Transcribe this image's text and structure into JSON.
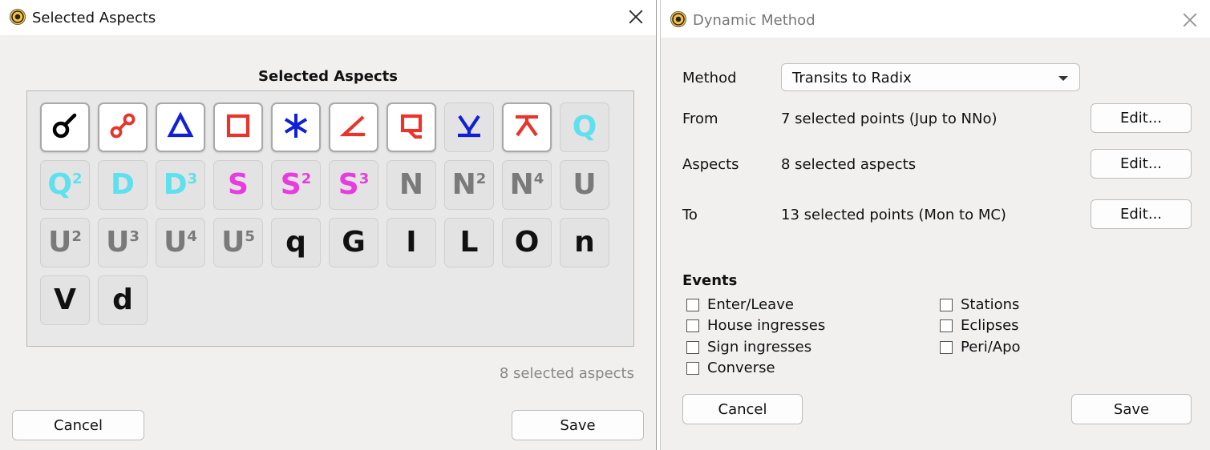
{
  "aspects_window": {
    "title": "Selected Aspects",
    "heading": "Selected Aspects",
    "status": "8 selected aspects",
    "cancel_label": "Cancel",
    "save_label": "Save",
    "aspects": [
      {
        "icon": "conjunction-icon",
        "selected": true,
        "color": "#000000"
      },
      {
        "icon": "opposition-icon",
        "selected": true,
        "color": "#e8352b"
      },
      {
        "icon": "trine-icon",
        "selected": true,
        "color": "#1020d8"
      },
      {
        "icon": "square-icon",
        "selected": true,
        "color": "#e8352b"
      },
      {
        "icon": "sextile-icon",
        "selected": true,
        "color": "#1020d8"
      },
      {
        "icon": "semisquare-icon",
        "selected": true,
        "color": "#e8352b"
      },
      {
        "icon": "sesquisquare-icon",
        "selected": true,
        "color": "#e8352b"
      },
      {
        "icon": "semisextile-icon",
        "selected": false,
        "color": "#1020d8"
      },
      {
        "icon": "quincunx-icon",
        "selected": true,
        "color": "#e8352b"
      },
      {
        "text": "Q",
        "sup": "",
        "selected": false,
        "color": "#5ee0ef"
      },
      {
        "text": "Q",
        "sup": "2",
        "selected": false,
        "color": "#5ee0ef"
      },
      {
        "text": "D",
        "sup": "",
        "selected": false,
        "color": "#5ee0ef"
      },
      {
        "text": "D",
        "sup": "3",
        "selected": false,
        "color": "#5ee0ef"
      },
      {
        "text": "S",
        "sup": "",
        "selected": false,
        "color": "#e83ce0"
      },
      {
        "text": "S",
        "sup": "2",
        "selected": false,
        "color": "#e83ce0"
      },
      {
        "text": "S",
        "sup": "3",
        "selected": false,
        "color": "#e83ce0"
      },
      {
        "text": "N",
        "sup": "",
        "selected": false,
        "color": "#7a7a7a"
      },
      {
        "text": "N",
        "sup": "2",
        "selected": false,
        "color": "#7a7a7a"
      },
      {
        "text": "N",
        "sup": "4",
        "selected": false,
        "color": "#7a7a7a"
      },
      {
        "text": "U",
        "sup": "",
        "selected": false,
        "color": "#7a7a7a"
      },
      {
        "text": "U",
        "sup": "2",
        "selected": false,
        "color": "#7a7a7a"
      },
      {
        "text": "U",
        "sup": "3",
        "selected": false,
        "color": "#7a7a7a"
      },
      {
        "text": "U",
        "sup": "4",
        "selected": false,
        "color": "#7a7a7a"
      },
      {
        "text": "U",
        "sup": "5",
        "selected": false,
        "color": "#7a7a7a"
      },
      {
        "text": "q",
        "sup": "",
        "selected": false,
        "color": "#111111"
      },
      {
        "text": "G",
        "sup": "",
        "selected": false,
        "color": "#111111"
      },
      {
        "text": "I",
        "sup": "",
        "selected": false,
        "color": "#111111"
      },
      {
        "text": "L",
        "sup": "",
        "selected": false,
        "color": "#111111"
      },
      {
        "text": "O",
        "sup": "",
        "selected": false,
        "color": "#111111"
      },
      {
        "text": "n",
        "sup": "",
        "selected": false,
        "color": "#111111"
      },
      {
        "text": "V",
        "sup": "",
        "selected": false,
        "color": "#111111"
      },
      {
        "text": "d",
        "sup": "",
        "selected": false,
        "color": "#111111"
      }
    ]
  },
  "dynamic_window": {
    "title": "Dynamic Method",
    "method_label": "Method",
    "method_value": "Transits to Radix",
    "from_label": "From",
    "from_value": "7 selected points (Jup to NNo)",
    "aspects_label": "Aspects",
    "aspects_value": "8 selected aspects",
    "to_label": "To",
    "to_value": "13 selected points (Mon to MC)",
    "edit_label": "Edit...",
    "events_heading": "Events",
    "events_left": [
      {
        "label": "Enter/Leave",
        "checked": false
      },
      {
        "label": "House ingresses",
        "checked": false
      },
      {
        "label": "Sign ingresses",
        "checked": false
      },
      {
        "label": "Converse",
        "checked": false
      }
    ],
    "events_right": [
      {
        "label": "Stations",
        "checked": false
      },
      {
        "label": "Eclipses",
        "checked": false
      },
      {
        "label": "Peri/Apo",
        "checked": false
      }
    ],
    "cancel_label": "Cancel",
    "save_label": "Save"
  }
}
